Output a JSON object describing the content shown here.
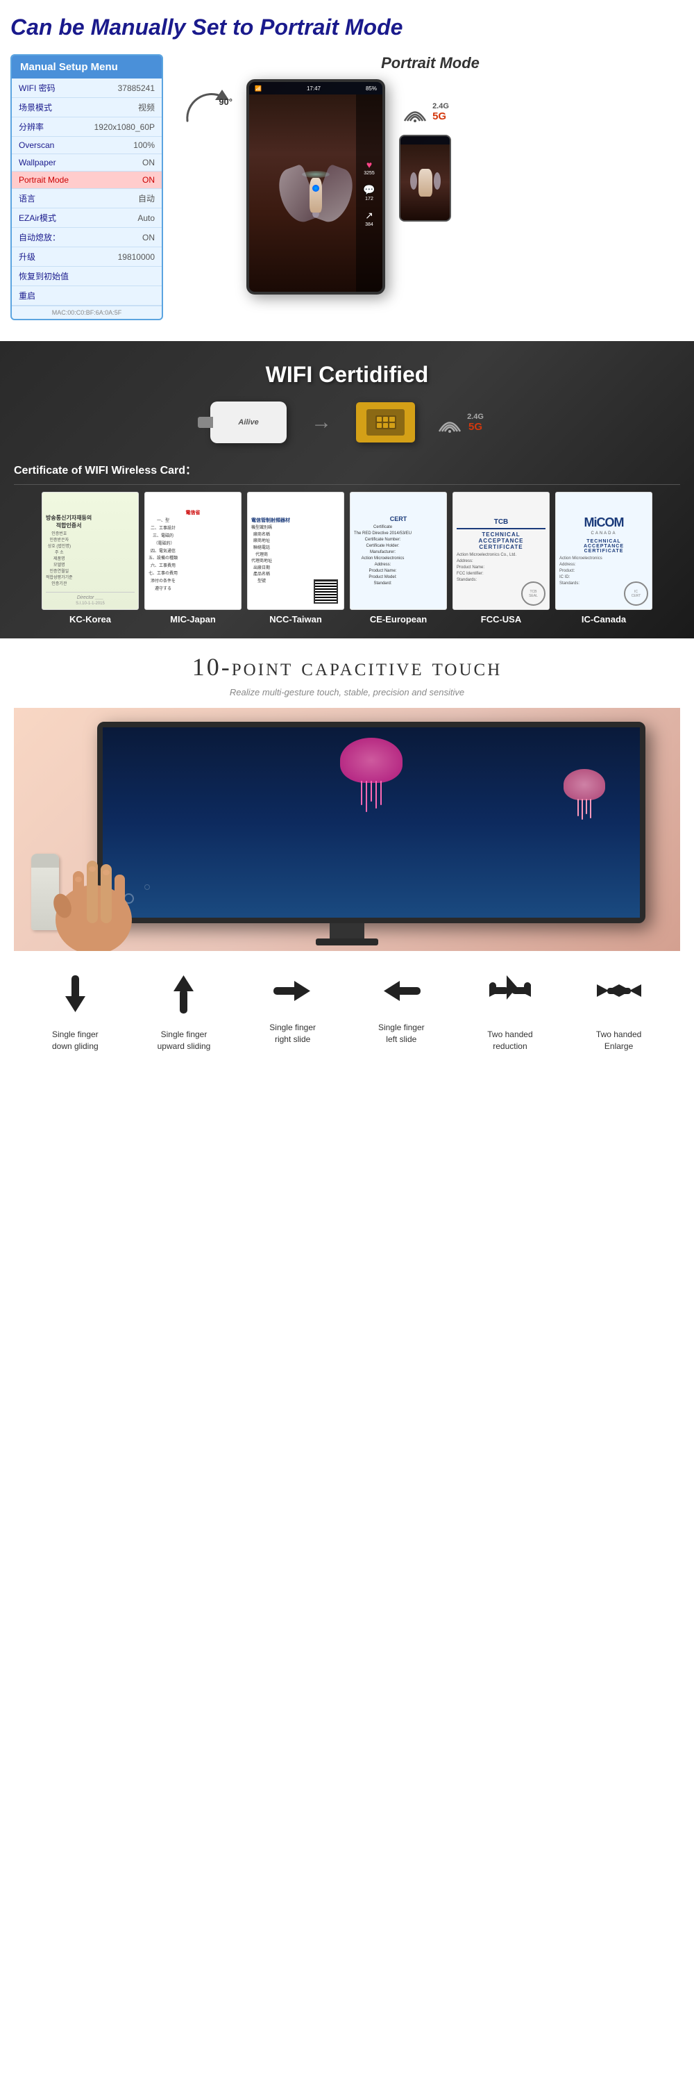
{
  "section1": {
    "heading": "Can be Manually Set to Portrait Mode",
    "portrait_mode_label": "Portrait Mode",
    "rotation_degree": "90°",
    "wifi_24": "2.4G",
    "wifi_5g": "5G",
    "menu": {
      "title": "Manual Setup Menu",
      "rows": [
        {
          "label": "WIFI 密码",
          "value": "37885241"
        },
        {
          "label": "场景模式",
          "value": "视频"
        },
        {
          "label": "分辨率",
          "value": "1920x1080_60P"
        },
        {
          "label": "Overscan",
          "value": "100%"
        },
        {
          "label": "Wallpaper",
          "value": "ON"
        },
        {
          "label": "Portrait Mode",
          "value": "ON",
          "highlight": true
        },
        {
          "label": "语言",
          "value": "自动"
        },
        {
          "label": "EZAir模式",
          "value": "Auto"
        },
        {
          "label": "自动熄放：",
          "value": "ON"
        },
        {
          "label": "升级",
          "value": "19810000"
        },
        {
          "label": "恢复到初始值",
          "value": ""
        },
        {
          "label": "重启",
          "value": ""
        }
      ],
      "mac": "MAC:00:C0:BF:6A:0A:5F"
    },
    "phone_status": {
      "time": "17:47",
      "battery": "85%"
    },
    "sidebar_items": [
      {
        "icon": "♥",
        "count": "3255"
      },
      {
        "icon": "💬",
        "count": "172"
      },
      {
        "icon": "↗",
        "count": "384"
      }
    ]
  },
  "section2": {
    "title": "WIFI Certidified",
    "usb_label": "Ailive",
    "arrow": "→",
    "wifi_24": "2.4G",
    "wifi_5g": "5G",
    "cert_of_label": "Certificate of WIFI Wireless Card：",
    "certificates": [
      {
        "name": "KC-Korea",
        "title": "방송통신기자재등의 적합인증서",
        "body": "인증받은자\n상호 (법인명)",
        "type": "korean"
      },
      {
        "name": "MIC-Japan",
        "title": "電信省告示",
        "body": "一、型\n二、工事\n三、電磁的",
        "type": "japanese"
      },
      {
        "name": "NCC-Taiwan",
        "title": "電信管制射頻器材",
        "body": "機型識別碼\n廠商名稱",
        "type": "taiwanese"
      },
      {
        "name": "CE-European",
        "title": "CERT",
        "body": "Certificate\nThe RED Directive 2014/53/EU",
        "type": "european"
      },
      {
        "name": "FCC-USA",
        "title": "TCB",
        "body": "TECHNICAL\nACCEPTANCE\nCERTIFICATE",
        "type": "fcc"
      },
      {
        "name": "IC-Canada",
        "title": "MiCOM",
        "body": "TECHNICAL\nACCEPTANCE\nCERTIFICATE",
        "type": "micom"
      }
    ]
  },
  "section3": {
    "title": "10-point capacitive touch",
    "subtitle": "Realize multi-gesture touch, stable, precision and sensitive",
    "gestures": [
      {
        "label": "Single finger\ndown gliding",
        "icon": "☟"
      },
      {
        "label": "Single finger\nupward sliding",
        "icon": "☝"
      },
      {
        "label": "Single finger\nright slide",
        "icon": "👉"
      },
      {
        "label": "Single finger\nleft slide",
        "icon": "👈"
      },
      {
        "label": "Two handed\nreduction",
        "icon": "🤏"
      },
      {
        "label": "Two handed\nEnlarge",
        "icon": "👐"
      }
    ]
  }
}
